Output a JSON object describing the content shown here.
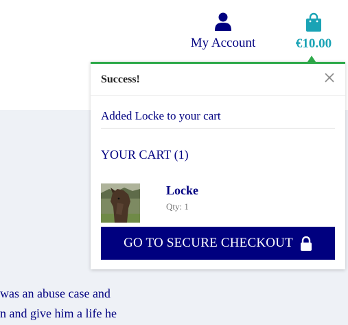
{
  "header": {
    "account_label": "My Account",
    "account_icon": "user-icon",
    "cart_total": "€10.00",
    "cart_icon": "shopping-bag-icon",
    "colors": {
      "brand": "#000080",
      "cart_accent": "#1aa3b5"
    }
  },
  "popup": {
    "title": "Success!",
    "close_icon": "close-icon",
    "added_message": "Added Locke to your cart",
    "cart_heading": "YOUR CART (1)",
    "item": {
      "name": "Locke",
      "qty": "Qty: 1",
      "thumbnail_icon": "horse-thumbnail"
    },
    "checkout_label": "GO TO SECURE CHECKOUT",
    "checkout_icon": "lock-icon",
    "colors": {
      "success_bar": "#2eaa4a",
      "checkout_bg": "#00007f"
    }
  },
  "body": {
    "lines": [
      "was an abuse case and",
      "n and give him a life he"
    ]
  }
}
